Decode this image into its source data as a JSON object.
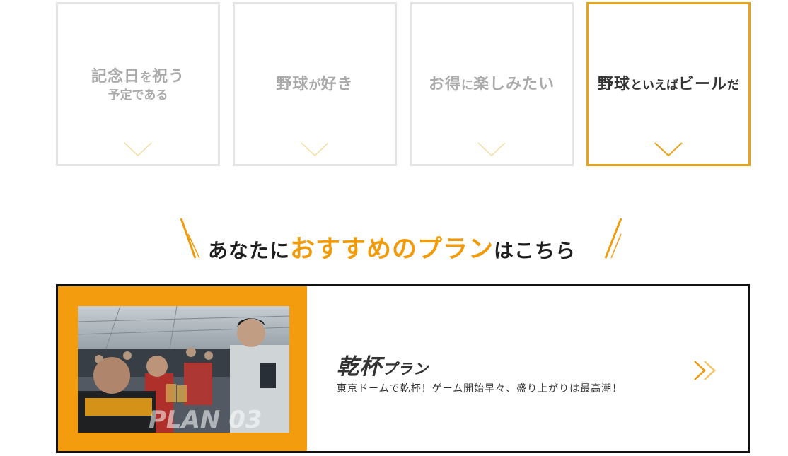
{
  "cards": [
    {
      "line1_big1": "記念日",
      "line1_small": "を",
      "line1_big2": "祝う",
      "line2": "予定である",
      "active": false
    },
    {
      "big1": "野球",
      "small1": "が",
      "big2": "好き",
      "small2": "",
      "active": false
    },
    {
      "big1": "お得",
      "small1": "に",
      "big2": "楽しみたい",
      "small2": "",
      "active": false
    },
    {
      "big1": "野球",
      "small1": "といえば",
      "big2": "ビール",
      "small2": "だ",
      "active": true
    }
  ],
  "heading": {
    "part1": "あなたに",
    "highlight": "おすすめのプラン",
    "part2": "はこちら"
  },
  "plan": {
    "title_kanji": "乾杯",
    "title_suffix": "プラン",
    "description": "東京ドームで乾杯！ゲーム開始早々、盛り上がりは最高潮！",
    "photo_overlay": "PLAN 03"
  },
  "colors": {
    "accent": "#f19b0b",
    "card_border": "#e4e4e4",
    "card_active_border": "#e8a318",
    "inactive_text": "#aaaaaa",
    "dark_text": "#333333"
  },
  "icons": {
    "card_chevron": "chevron-down-icon",
    "plan_arrow": "double-chevron-right-icon",
    "heading_decoration": "slash-decoration"
  }
}
